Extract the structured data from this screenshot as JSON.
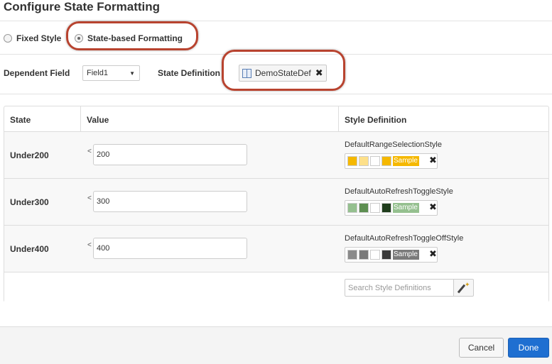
{
  "dialog": {
    "title": "Configure State Formatting"
  },
  "format_mode": {
    "options": [
      "Fixed Style",
      "State-based Formatting"
    ],
    "selected": "State-based Formatting"
  },
  "dependent_field": {
    "label": "Dependent Field",
    "value": "Field1"
  },
  "state_definition": {
    "label": "State Definition",
    "value": "DemoStateDef"
  },
  "table": {
    "headers": {
      "state": "State",
      "value": "Value",
      "style": "Style Definition"
    },
    "rows": [
      {
        "state": "Under200",
        "operator": "<",
        "value": "200",
        "style_name": "DefaultRangeSelectionStyle",
        "sample_label": "Sample",
        "colors": [
          "#f5b800",
          "#fde08a",
          "#ffffff",
          "#f5b800"
        ]
      },
      {
        "state": "Under300",
        "operator": "<",
        "value": "300",
        "style_name": "DefaultAutoRefreshToggleStyle",
        "sample_label": "Sample",
        "colors": [
          "#95c08f",
          "#5e8f52",
          "#ffffff",
          "#1f3d1c"
        ]
      },
      {
        "state": "Under400",
        "operator": "<",
        "value": "400",
        "style_name": "DefaultAutoRefreshToggleOffStyle",
        "sample_label": "Sample",
        "colors": [
          "#8a8a8a",
          "#7a7a7a",
          "#ffffff",
          "#3a3a3a"
        ]
      }
    ],
    "search_placeholder": "Search Style Definitions"
  },
  "footer": {
    "cancel_label": "Cancel",
    "done_label": "Done"
  },
  "colors": {
    "highlight": "#b8432f",
    "primary": "#1f6fd1"
  }
}
